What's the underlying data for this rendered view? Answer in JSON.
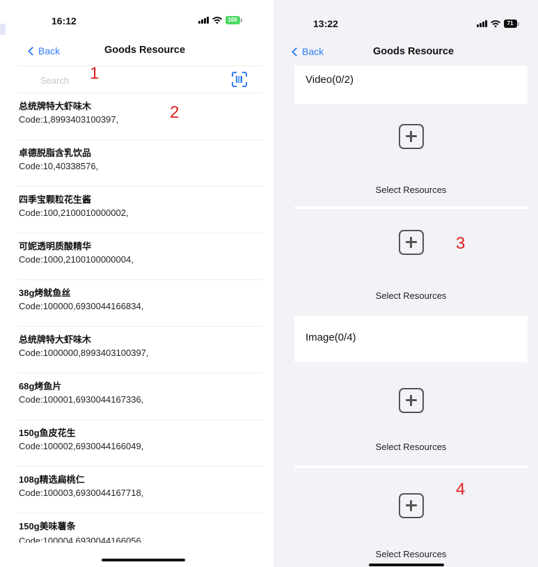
{
  "left_screen": {
    "status_bar": {
      "time": "16:12",
      "battery_level": "100",
      "battery_color": "#4cd964"
    },
    "nav": {
      "back_label": "Back",
      "title": "Goods Resource"
    },
    "search": {
      "placeholder": "Search",
      "value": "",
      "scan_icon": "barcode-scan-icon"
    },
    "annotations": {
      "search": "1",
      "list": "2"
    },
    "goods": [
      {
        "name": "总统牌特大虾味木",
        "code": "Code:1,8993403100397,"
      },
      {
        "name": "卓德脱脂含乳饮品",
        "code": "Code:10,40338576,"
      },
      {
        "name": "四季宝颗粒花生酱",
        "code": "Code:100,2100010000002,"
      },
      {
        "name": "可妮透明质酸精华",
        "code": "Code:1000,2100100000004,"
      },
      {
        "name": "38g烤鱿鱼丝",
        "code": "Code:100000,6930044166834,"
      },
      {
        "name": "总统牌特大虾味木",
        "code": "Code:1000000,8993403100397,"
      },
      {
        "name": "68g烤鱼片",
        "code": "Code:100001,6930044167336,"
      },
      {
        "name": "150g鱼皮花生",
        "code": "Code:100002,6930044166049,"
      },
      {
        "name": "108g精选扁桃仁",
        "code": "Code:100003,6930044167718,"
      },
      {
        "name": "150g美味薯条",
        "code": "Code:100004,6930044166056"
      }
    ]
  },
  "right_screen": {
    "status_bar": {
      "time": "13:22",
      "battery_level": "71",
      "battery_color": "#111111"
    },
    "nav": {
      "back_label": "Back",
      "title": "Goods Resource"
    },
    "video_section": {
      "title": "Video(0/2)",
      "slots": [
        {
          "label": "Select Resources"
        },
        {
          "label": "Select Resources"
        }
      ]
    },
    "image_section": {
      "title": "Image(0/4)",
      "slots": [
        {
          "label": "Select Resources"
        },
        {
          "label": "Select Resources"
        }
      ]
    },
    "annotations": {
      "video_slot": "3",
      "image_slot": "4"
    }
  },
  "colors": {
    "accent_blue": "#2f7cf6",
    "annotation_red": "#e02020",
    "background_gray": "#f2f2f7"
  }
}
